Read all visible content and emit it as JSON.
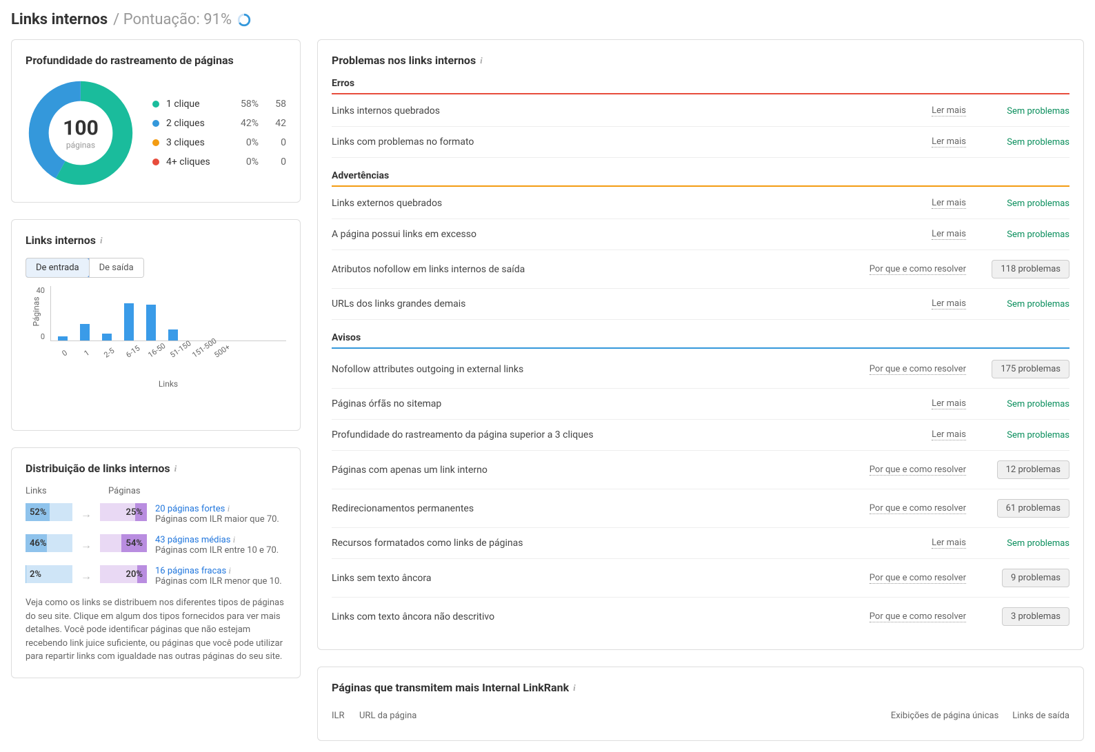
{
  "header": {
    "title": "Links internos",
    "score_label": "/ Pontuação: 91%"
  },
  "depth_card": {
    "title": "Profundidade do rastreamento de páginas",
    "center_value": "100",
    "center_label": "páginas",
    "legend": [
      {
        "label": "1 clique",
        "pct": "58%",
        "count": "58",
        "color": "#1abc9c"
      },
      {
        "label": "2 cliques",
        "pct": "42%",
        "count": "42",
        "color": "#3498db"
      },
      {
        "label": "3 cliques",
        "pct": "0%",
        "count": "0",
        "color": "#f39c12"
      },
      {
        "label": "4+ cliques",
        "pct": "0%",
        "count": "0",
        "color": "#e74c3c"
      }
    ]
  },
  "links_card": {
    "title": "Links internos",
    "tab_in": "De entrada",
    "tab_out": "De saída",
    "y_label": "Páginas",
    "x_label": "Links",
    "y_ticks": [
      "40",
      "0"
    ]
  },
  "dist_card": {
    "title": "Distribuição de links internos",
    "col_links": "Links",
    "col_pages": "Páginas",
    "rows": [
      {
        "links_pct": "52%",
        "links_fill": 52,
        "pages_pct": "25%",
        "pages_fill": 25,
        "link_text": "20 páginas fortes",
        "desc": "Páginas com ILR maior que 70."
      },
      {
        "links_pct": "46%",
        "links_fill": 46,
        "pages_pct": "54%",
        "pages_fill": 54,
        "link_text": "43 páginas médias",
        "desc": "Páginas com ILR entre 10 e 70."
      },
      {
        "links_pct": "2%",
        "links_fill": 2,
        "pages_pct": "20%",
        "pages_fill": 20,
        "link_text": "16 páginas fracas",
        "desc": "Páginas com ILR menor que 10."
      }
    ],
    "footer": "Veja como os links se distribuem nos diferentes tipos de páginas do seu site. Clique em algum dos tipos fornecidos para ver mais detalhes. Você pode identificar páginas que não estejam recebendo link juice suficiente, ou páginas que você pode utilizar para repartir links com igualdade nas outras páginas do seu site."
  },
  "problems_card": {
    "title": "Problemas nos links internos",
    "status_ok": "Sem problemas",
    "action_read": "Ler mais",
    "action_why": "Por que e como resolver",
    "sections": [
      {
        "name": "Erros",
        "color": "red",
        "rows": [
          {
            "label": "Links internos quebrados",
            "action": "read",
            "status": "ok"
          },
          {
            "label": "Links com problemas no formato",
            "action": "read",
            "status": "ok"
          }
        ]
      },
      {
        "name": "Advertências",
        "color": "orange",
        "rows": [
          {
            "label": "Links externos quebrados",
            "action": "read",
            "status": "ok"
          },
          {
            "label": "A página possui links em excesso",
            "action": "read",
            "status": "ok"
          },
          {
            "label": "Atributos nofollow em links internos de saída",
            "action": "why",
            "status": "count",
            "count": "118 problemas"
          },
          {
            "label": "URLs dos links grandes demais",
            "action": "read",
            "status": "ok"
          }
        ]
      },
      {
        "name": "Avisos",
        "color": "blue",
        "rows": [
          {
            "label": "Nofollow attributes outgoing in external links",
            "action": "why",
            "status": "count",
            "count": "175 problemas"
          },
          {
            "label": "Páginas órfãs no sitemap",
            "action": "read",
            "status": "ok"
          },
          {
            "label": "Profundidade do rastreamento da página superior a 3 cliques",
            "action": "read",
            "status": "ok"
          },
          {
            "label": "Páginas com apenas um link interno",
            "action": "why",
            "status": "count",
            "count": "12 problemas"
          },
          {
            "label": "Redirecionamentos permanentes",
            "action": "why",
            "status": "count",
            "count": "61 problemas"
          },
          {
            "label": "Recursos formatados como links de páginas",
            "action": "read",
            "status": "ok"
          },
          {
            "label": "Links sem texto âncora",
            "action": "why",
            "status": "count",
            "count": "9 problemas"
          },
          {
            "label": "Links com texto âncora não descritivo",
            "action": "why",
            "status": "count",
            "count": "3 problemas"
          }
        ]
      }
    ]
  },
  "ilr_card": {
    "title": "Páginas que transmitem mais Internal LinkRank",
    "th_ilr": "ILR",
    "th_url": "URL da página",
    "th_unique": "Exibições de página únicas",
    "th_exit": "Links de saída"
  },
  "chart_data": [
    {
      "type": "pie",
      "title": "Profundidade do rastreamento de páginas",
      "series": [
        {
          "name": "1 clique",
          "value": 58
        },
        {
          "name": "2 cliques",
          "value": 42
        },
        {
          "name": "3 cliques",
          "value": 0
        },
        {
          "name": "4+ cliques",
          "value": 0
        }
      ],
      "total_label": "100 páginas"
    },
    {
      "type": "bar",
      "title": "Links internos (De entrada)",
      "xlabel": "Links",
      "ylabel": "Páginas",
      "categories": [
        "0",
        "1",
        "2-5",
        "6-15",
        "16-50",
        "51-150",
        "151-500",
        "500+"
      ],
      "values": [
        3,
        12,
        5,
        27,
        26,
        8,
        0,
        0
      ],
      "ylim": [
        0,
        40
      ]
    }
  ]
}
